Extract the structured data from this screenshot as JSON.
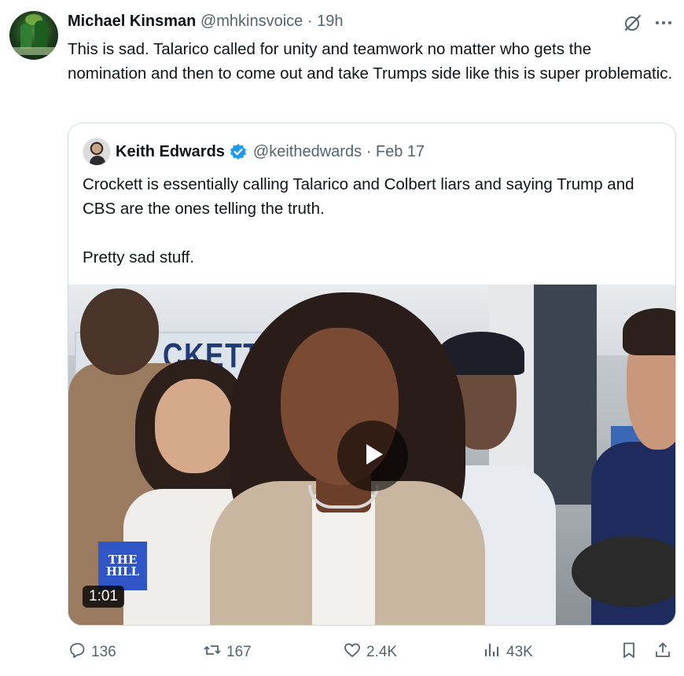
{
  "post": {
    "author_name": "Michael Kinsman",
    "author_handle": "@mhkinsvoice",
    "separator": "·",
    "time": "19h",
    "text": "This is sad. Talarico called for unity and teamwork no matter who gets the nomination and then to come out and take Trumps side like this is super problematic."
  },
  "quote": {
    "author_name": "Keith Edwards",
    "author_handle": "@keithedwards",
    "separator": "·",
    "date": "Feb 17",
    "text": "Crockett is essentially calling Talarico and Colbert liars and saying Trump and CBS are the ones telling the truth.\n\nPretty sad stuff.",
    "video": {
      "duration": "1:01",
      "logo_line1": "THE",
      "logo_line2": "HILL",
      "sign_text": "CKETT"
    }
  },
  "actions": {
    "replies": "136",
    "reposts": "167",
    "likes": "2.4K",
    "views": "43K"
  },
  "colors": {
    "text": "#0f1419",
    "muted": "#536471",
    "verified": "#1d9bf0",
    "border": "#cfd9de"
  },
  "icons": [
    "grok-icon",
    "more-icon",
    "verified-icon",
    "play-icon",
    "reply-icon",
    "repost-icon",
    "like-icon",
    "views-icon",
    "bookmark-icon",
    "share-icon"
  ]
}
